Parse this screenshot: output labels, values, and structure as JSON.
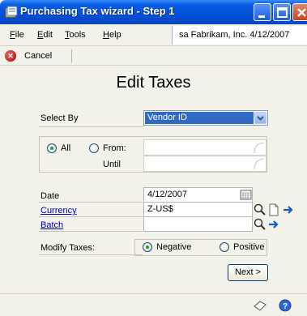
{
  "window": {
    "title": "Purchasing Tax wizard - Step 1"
  },
  "menu": {
    "items": [
      {
        "accel": "F",
        "rest": "ile"
      },
      {
        "accel": "E",
        "rest": "dit"
      },
      {
        "accel": "T",
        "rest": "ools"
      },
      {
        "accel": "H",
        "rest": "elp"
      }
    ],
    "user_info": "sa  Fabrikam, Inc.  4/12/2007"
  },
  "toolbar": {
    "cancel_label": "Cancel"
  },
  "page": {
    "title": "Edit Taxes"
  },
  "select_by": {
    "label": "Select By",
    "value": "Vendor ID"
  },
  "range": {
    "all_label": "All",
    "from_label": "From:",
    "until_label": "Until",
    "selected": "All",
    "from_value": "",
    "until_value": ""
  },
  "fields": {
    "date_label": "Date",
    "date_value": "4/12/2007",
    "currency_label": "Currency",
    "currency_value": "Z-US$",
    "batch_label": "Batch",
    "batch_value": ""
  },
  "modify": {
    "label": "Modify Taxes:",
    "negative_label": "Negative",
    "positive_label": "Positive",
    "selected": "Negative"
  },
  "buttons": {
    "next_label": "Next >"
  },
  "colors": {
    "titlebar": "#0a5ee6",
    "link": "#0000cc",
    "selection": "#316ac5"
  }
}
